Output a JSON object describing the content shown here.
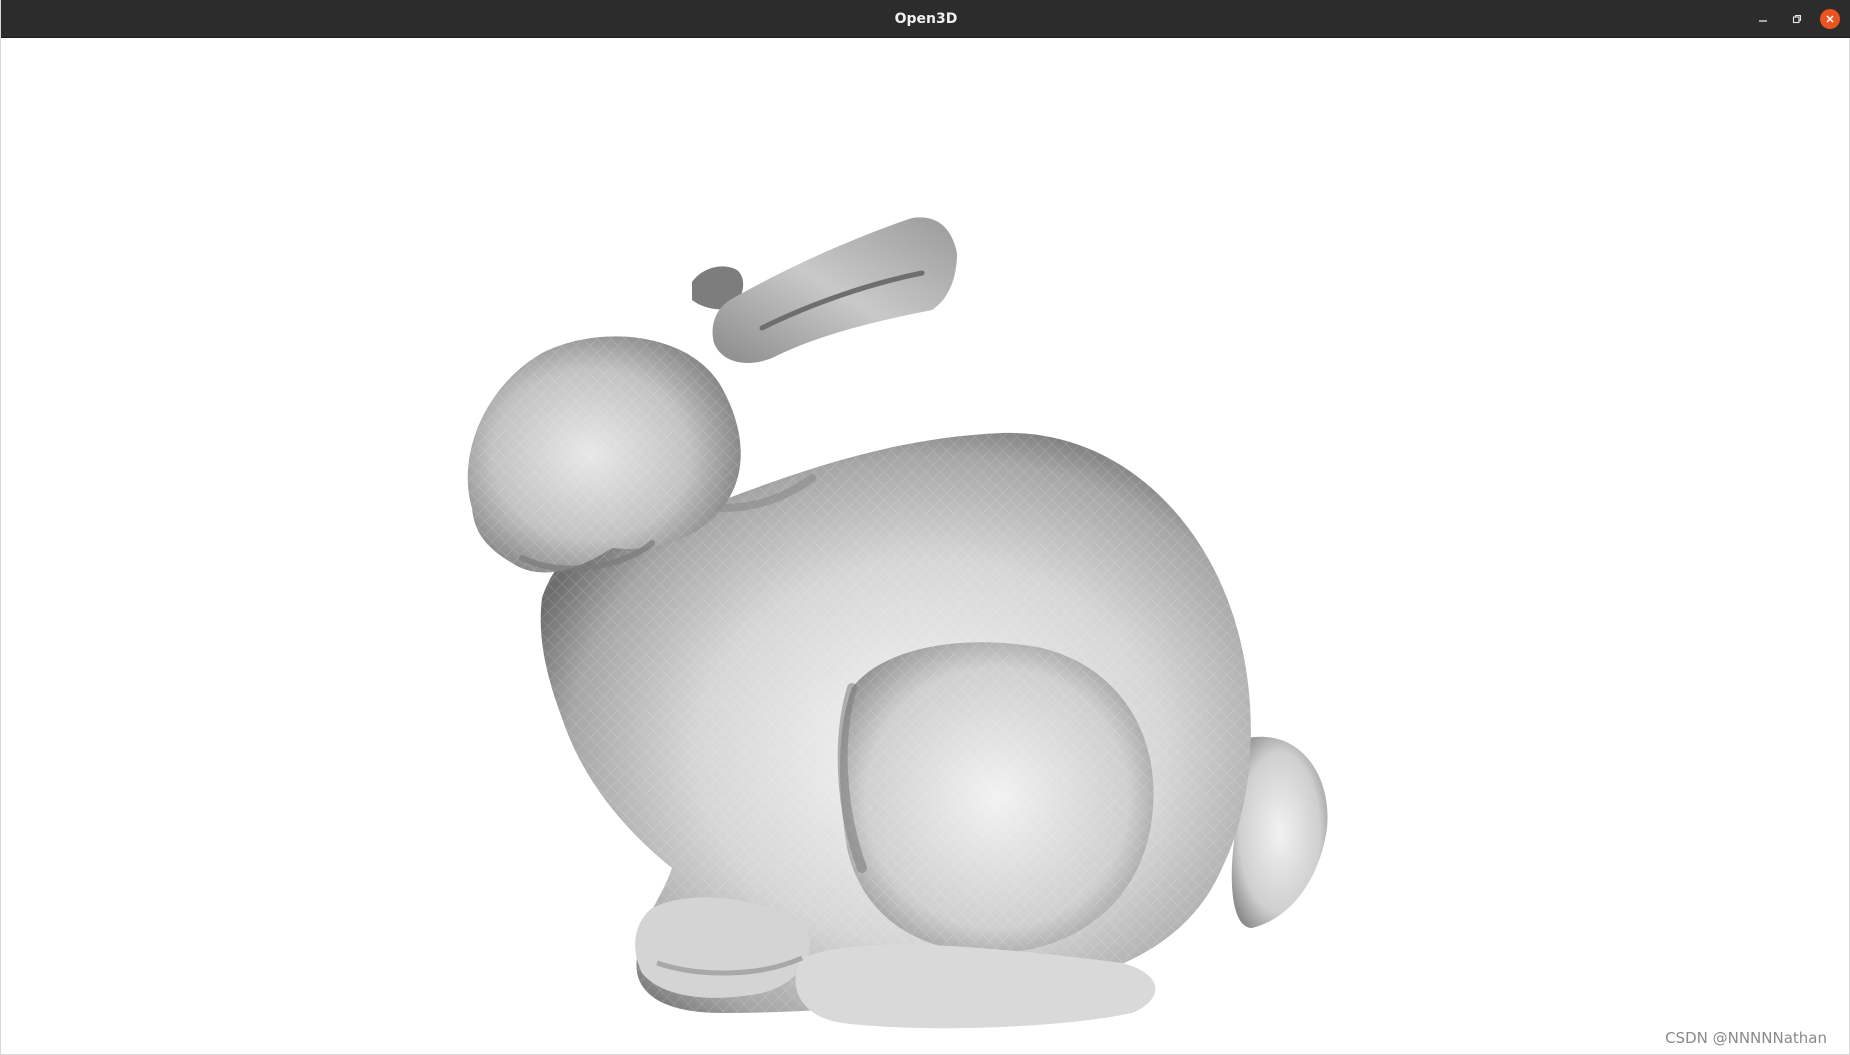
{
  "window": {
    "title": "Open3D",
    "controls": {
      "minimize": "minimize-icon",
      "maximize": "restore-icon",
      "close": "close-icon"
    },
    "accent_color": "#e95420",
    "titlebar_color": "#2c2c2c"
  },
  "viewport": {
    "background": "#ffffff",
    "model": "bunny-mesh"
  },
  "watermark": {
    "text": "CSDN @NNNNNathan"
  }
}
